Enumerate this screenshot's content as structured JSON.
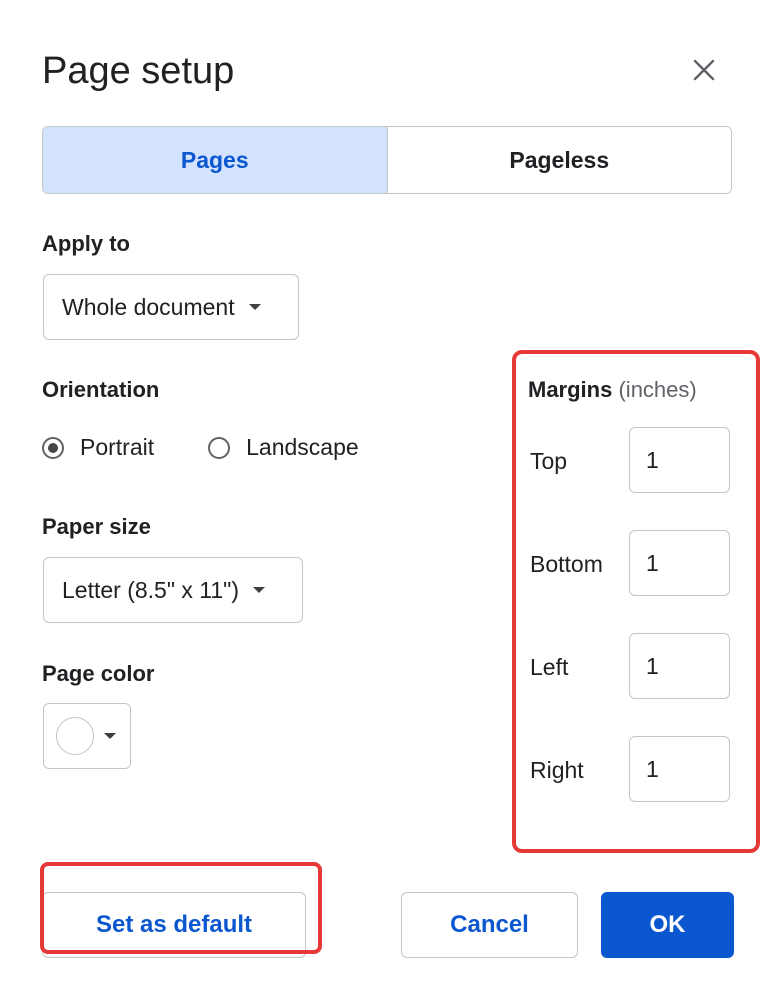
{
  "dialog": {
    "title": "Page setup",
    "close_icon": "close-icon"
  },
  "mode_toggle": {
    "tabs": [
      {
        "label": "Pages",
        "active": true
      },
      {
        "label": "Pageless",
        "active": false
      }
    ]
  },
  "apply_to": {
    "label": "Apply to",
    "value": "Whole document"
  },
  "orientation": {
    "label": "Orientation",
    "options": [
      {
        "label": "Portrait",
        "checked": true
      },
      {
        "label": "Landscape",
        "checked": false
      }
    ]
  },
  "paper_size": {
    "label": "Paper size",
    "value": "Letter (8.5\" x 11\")"
  },
  "page_color": {
    "label": "Page color",
    "value": "#ffffff"
  },
  "margins": {
    "heading": "Margins",
    "unit": "(inches)",
    "fields": [
      {
        "label": "Top",
        "value": "1"
      },
      {
        "label": "Bottom",
        "value": "1"
      },
      {
        "label": "Left",
        "value": "1"
      },
      {
        "label": "Right",
        "value": "1"
      }
    ]
  },
  "footer": {
    "set_default_label": "Set as default",
    "cancel_label": "Cancel",
    "ok_label": "OK"
  },
  "colors": {
    "accent": "#0b57d0",
    "highlight": "#e53935",
    "active_tab_bg": "#d3e3fd"
  }
}
